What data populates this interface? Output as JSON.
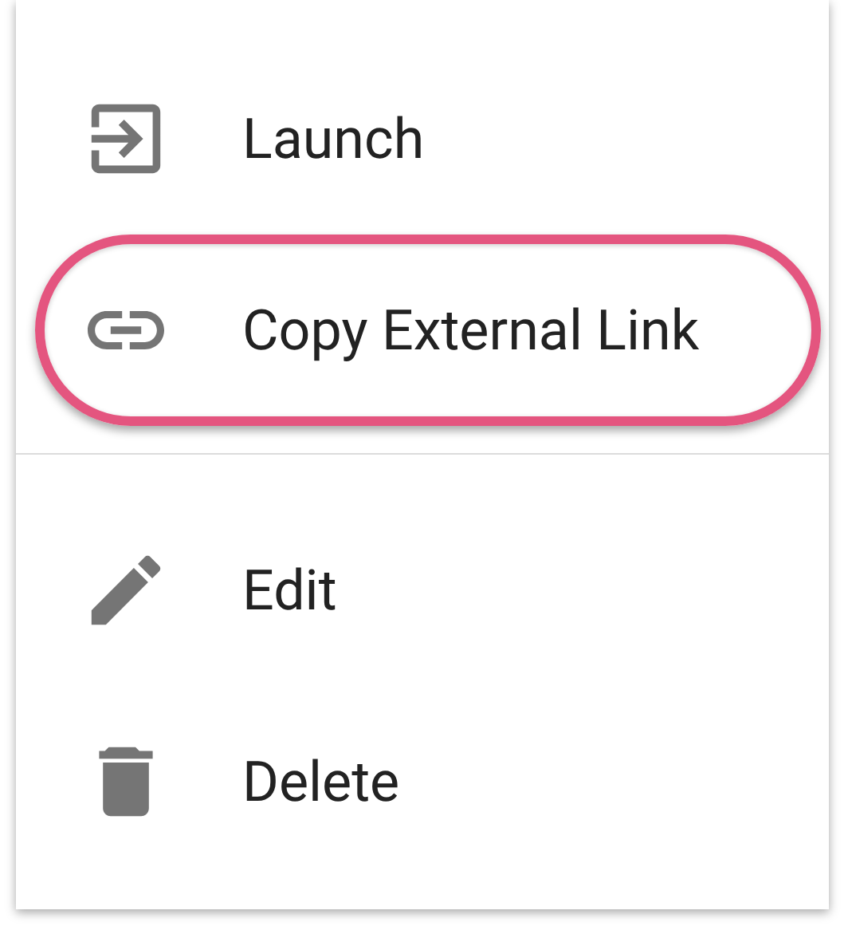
{
  "menu": {
    "groups": [
      {
        "items": [
          {
            "label": "Launch",
            "kind": "launch",
            "highlighted": false
          },
          {
            "label": "Copy External Link",
            "kind": "link",
            "highlighted": true
          }
        ]
      },
      {
        "items": [
          {
            "label": "Edit",
            "kind": "edit",
            "highlighted": false
          },
          {
            "label": "Delete",
            "kind": "delete",
            "highlighted": false
          }
        ]
      }
    ]
  }
}
